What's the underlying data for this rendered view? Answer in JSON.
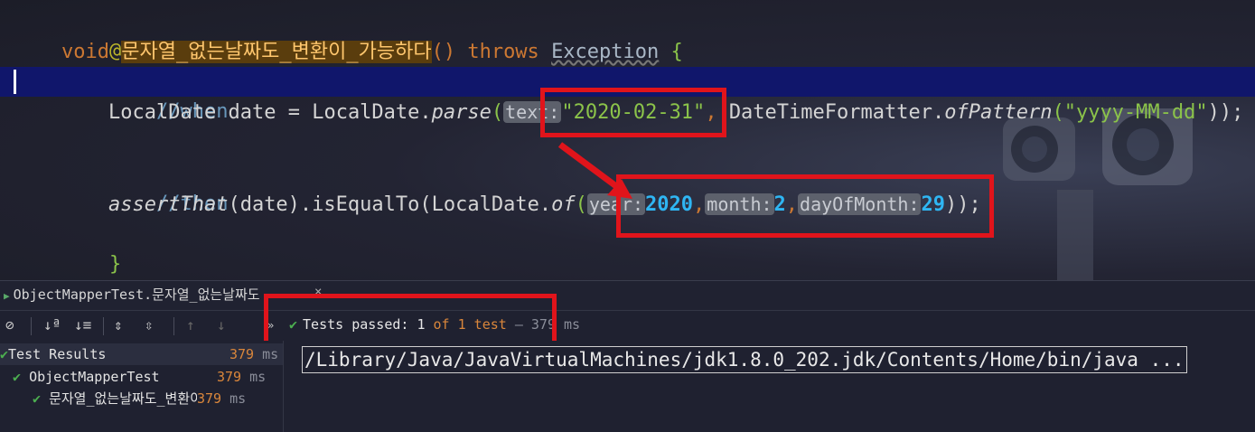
{
  "editor": {
    "annotation": "@Test",
    "method_kw": "void",
    "method_name": "문자열_없는날짜도_변환이_가능하다",
    "method_parens": "()",
    "throws_kw": "throws",
    "exception": "Exception",
    "open_brace": "{",
    "comment_when": "//when",
    "line_parse": {
      "type": "LocalDate",
      "var": "date",
      "eq": "=",
      "cls": "LocalDate.",
      "method": "parse",
      "open": "(",
      "hint_text": "text:",
      "date_string": "\"2020-02-31\"",
      "comma": ",",
      "formatter_cls": "DateTimeFormatter.",
      "formatter_method": "ofPattern",
      "open2": "(",
      "pattern": "\"yyyy-MM-dd\"",
      "close": "));"
    },
    "comment_then": "//then",
    "line_assert": {
      "method": "assertThat",
      "arg": "(date).isEqualTo(",
      "cls": "LocalDate.",
      "of": "of",
      "open": "(",
      "hint_year": "year:",
      "year": "2020",
      "hint_month": "month:",
      "month": "2",
      "hint_day": "dayOfMonth:",
      "day": "29",
      "close": "));",
      "comma": ","
    },
    "close_brace_inner": "}",
    "close_brace_outer": "}"
  },
  "run_panel": {
    "tab_label": "ObjectMapperTest.문자열_없는날짜도",
    "tab_close": "×",
    "status": {
      "prefix": "Tests passed:",
      "passed": "1",
      "of_text": "of 1 test",
      "dash": "–",
      "duration": "379 ms"
    },
    "tree": [
      {
        "label": "Test Results",
        "time": "379",
        "unit": "ms"
      },
      {
        "label": "ObjectMapperTest",
        "time": "379",
        "unit": "ms"
      },
      {
        "label": "문자열_없는날짜도_변환이_가",
        "time": "379",
        "unit": "ms"
      }
    ],
    "console_line": "/Library/Java/JavaVirtualMachines/jdk1.8.0_202.jdk/Contents/Home/bin/java ..."
  },
  "colors": {
    "highlight_line": "#10166b",
    "annotation_box": "#e0141b",
    "pass_green": "#4caf50"
  }
}
